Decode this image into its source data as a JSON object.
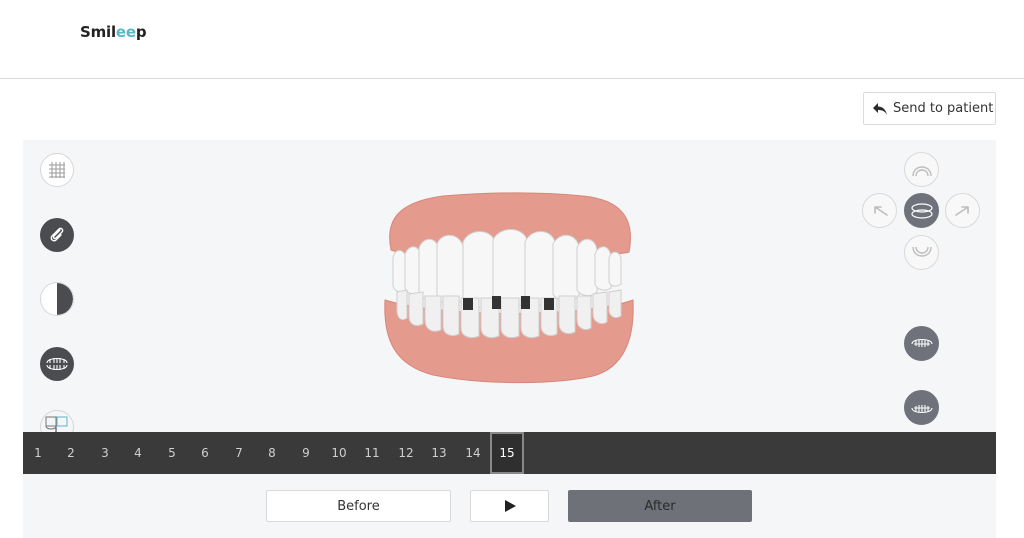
{
  "header": {
    "logo_prefix": "Smil",
    "logo_accent": "ee",
    "logo_suffix": "p"
  },
  "actions": {
    "send_label": "Send to patient"
  },
  "left_tools": [
    {
      "name": "grid-icon",
      "style": "light"
    },
    {
      "name": "attachment-icon",
      "style": "dark"
    },
    {
      "name": "contrast-icon",
      "style": "light"
    },
    {
      "name": "teeth-occlusion-icon",
      "style": "dark"
    },
    {
      "name": "ipr-chart-icon",
      "style": "light"
    },
    {
      "name": "upper-jaw-icon",
      "style": "dark"
    }
  ],
  "right_tools": [
    {
      "name": "upper-arch-view-icon"
    },
    {
      "name": "rotate-left-icon"
    },
    {
      "name": "front-view-icon"
    },
    {
      "name": "rotate-right-icon"
    },
    {
      "name": "lower-arch-view-icon"
    },
    {
      "name": "upper-teeth-toggle-icon"
    },
    {
      "name": "lower-teeth-toggle-icon"
    }
  ],
  "timeline": {
    "steps": [
      "1",
      "2",
      "3",
      "4",
      "5",
      "6",
      "7",
      "8",
      "9",
      "10",
      "11",
      "12",
      "13",
      "14",
      "15"
    ],
    "active": "15"
  },
  "controls": {
    "before_label": "Before",
    "after_label": "After",
    "play_icon": "play-icon"
  },
  "colors": {
    "gum": "#e3968a",
    "teeth": "#f6f6f6",
    "dark_tool": "#4a4c50",
    "active_nav": "#6f727a",
    "timeline_bg": "#3a3a3a",
    "after_button": "#6e7178",
    "logo_accent": "#5bb6c8"
  }
}
